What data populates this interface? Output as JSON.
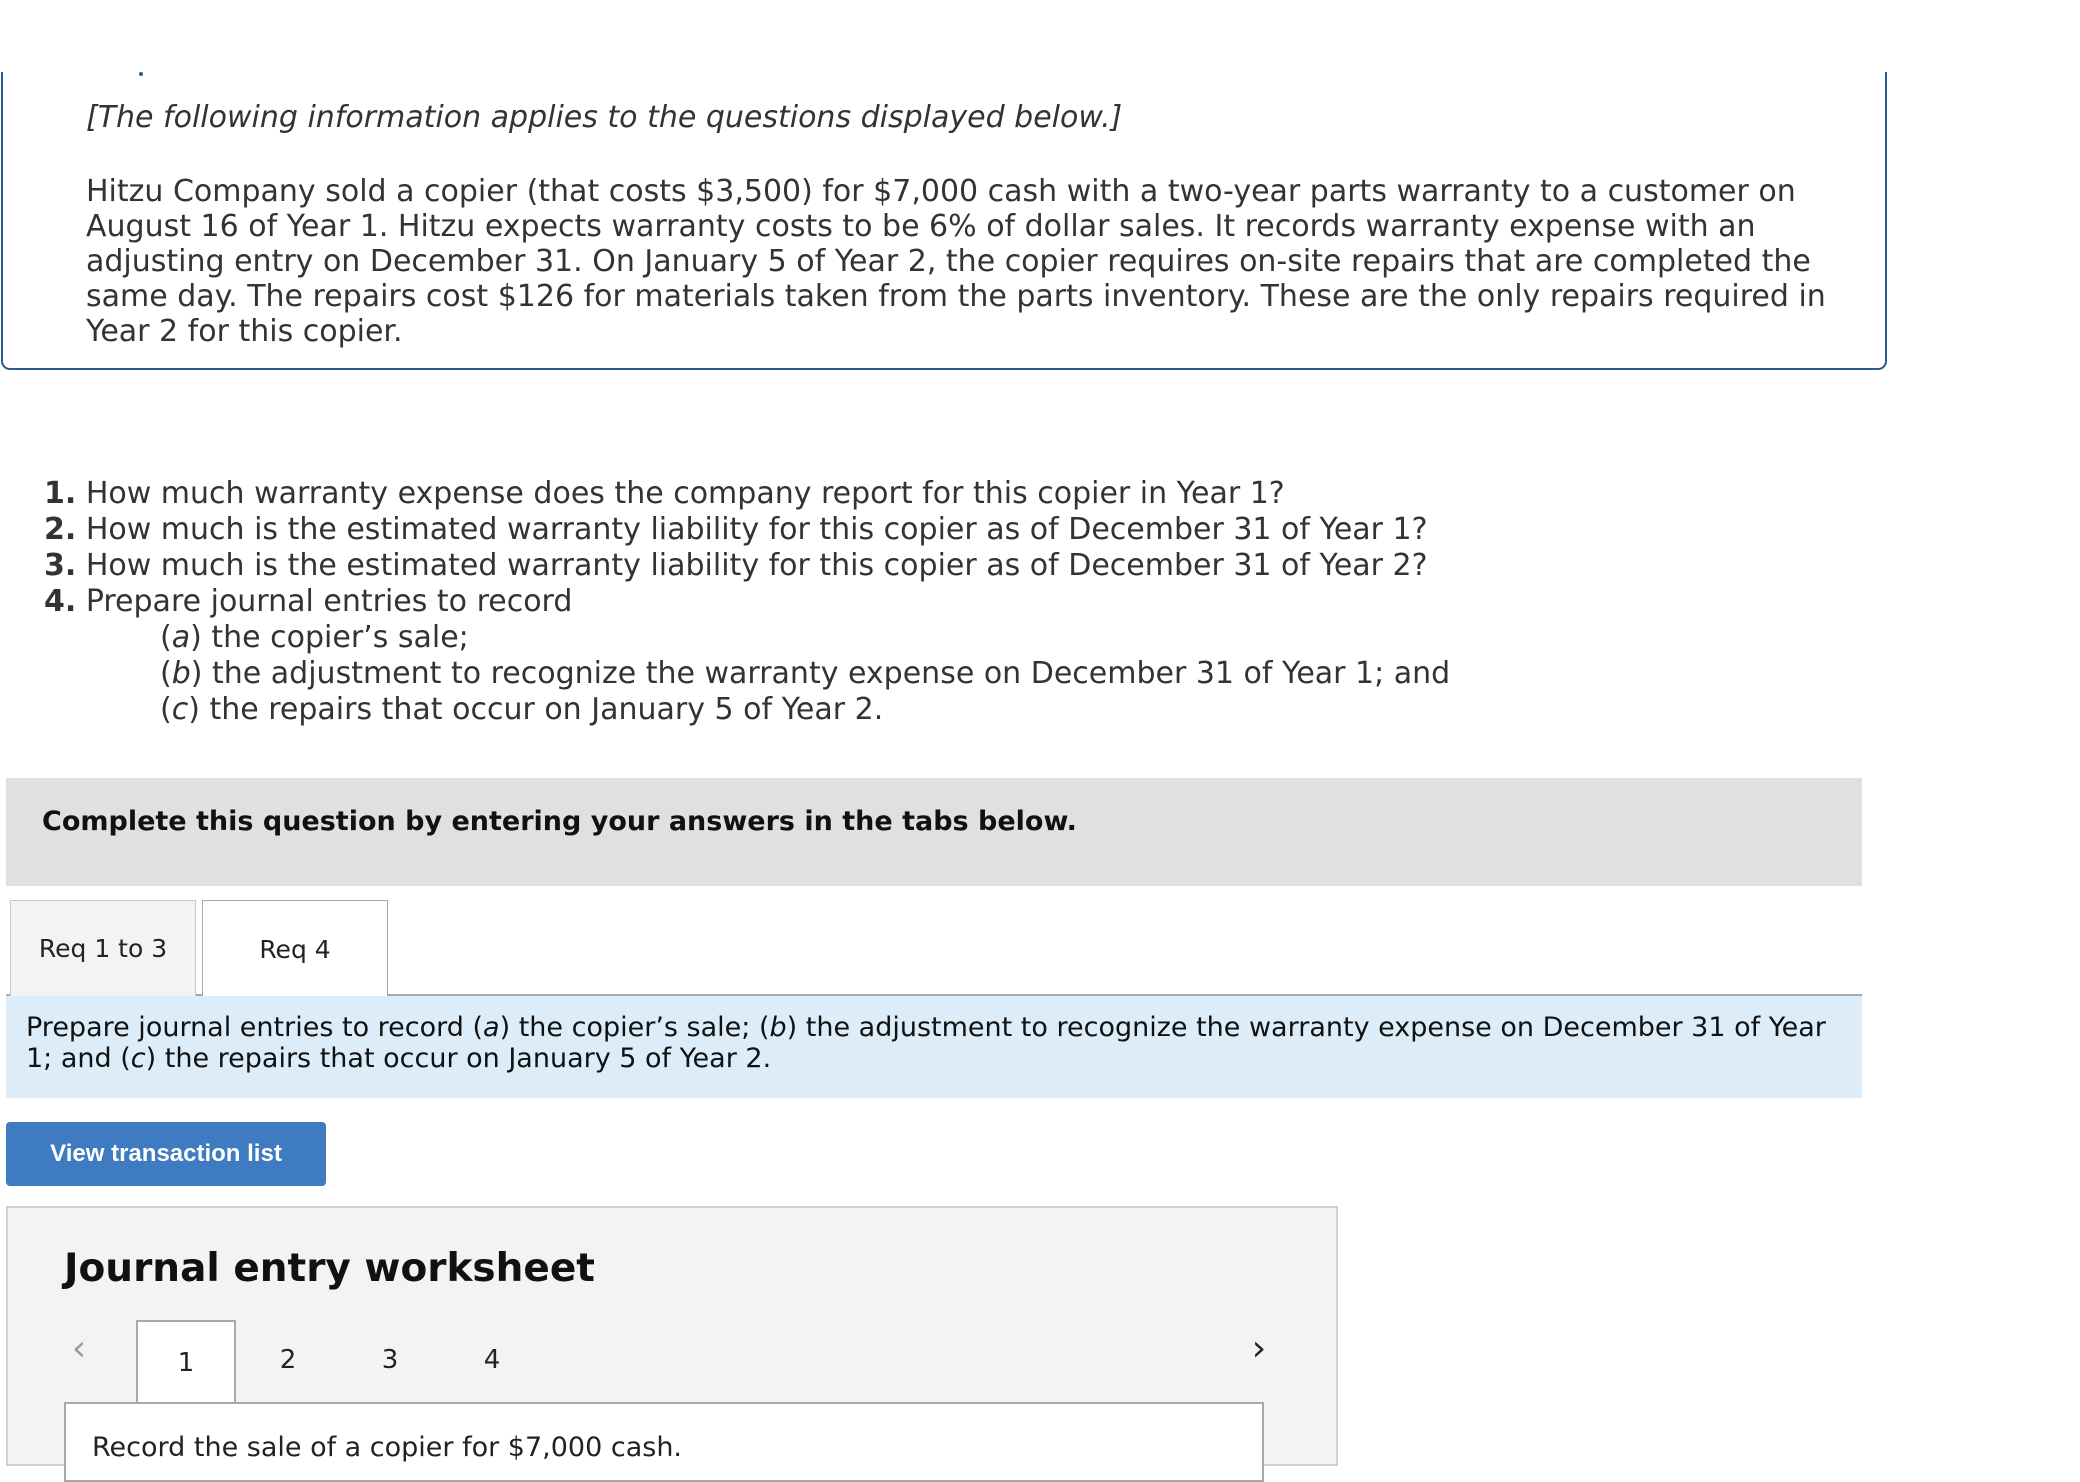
{
  "intro": "[The following information applies to the questions displayed below.]",
  "scenario": "Hitzu Company sold a copier (that costs $3,500) for $7,000 cash with a two-year parts warranty to a customer on August 16 of Year 1. Hitzu expects warranty costs to be 6% of dollar sales. It records warranty expense with an adjusting entry on December 31. On January 5 of Year 2, the copier requires on-site repairs that are completed the same day. The repairs cost $126 for materials taken from the parts inventory. These are the only repairs required in Year 2 for this copier.",
  "questions": [
    {
      "num": "1.",
      "text": " How much warranty expense does the company report for this copier in Year 1?"
    },
    {
      "num": "2.",
      "text": " How much is the estimated warranty liability for this copier as of December 31 of Year 1?"
    },
    {
      "num": "3.",
      "text": " How much is the estimated warranty liability for this copier as of December 31 of Year 2?"
    },
    {
      "num": "4.",
      "text": " Prepare journal entries to record"
    }
  ],
  "subitems": [
    {
      "open": "(",
      "letter": "a",
      "close": ")",
      "text": " the copier’s sale;"
    },
    {
      "open": "(",
      "letter": "b",
      "close": ")",
      "text": " the adjustment to recognize the warranty expense on December 31 of Year 1; and"
    },
    {
      "open": "(",
      "letter": "c",
      "close": ")",
      "text": " the repairs that occur on January 5 of Year 2."
    }
  ],
  "banner": "Complete this question by entering your answers in the tabs below.",
  "tabs": [
    "Req 1 to 3",
    "Req 4"
  ],
  "instruction": {
    "p1": "Prepare journal entries to record (",
    "a": "a",
    "p2": ") the copier’s sale; (",
    "b": "b",
    "p3": ") the adjustment to recognize the warranty expense on December 31 of Year 1; and (",
    "c": "c",
    "p4": ") the repairs that occur on January 5 of Year 2."
  },
  "view_button": "View transaction list",
  "worksheet": {
    "title": "Journal entry worksheet",
    "prev_icon": "chevron-left-icon",
    "next_icon": "chevron-right-icon",
    "prev_glyph": "‹",
    "next_glyph": "›",
    "pages": [
      "1",
      "2",
      "3",
      "4"
    ],
    "entry_text": "Record the sale of a copier for $7,000 cash."
  }
}
